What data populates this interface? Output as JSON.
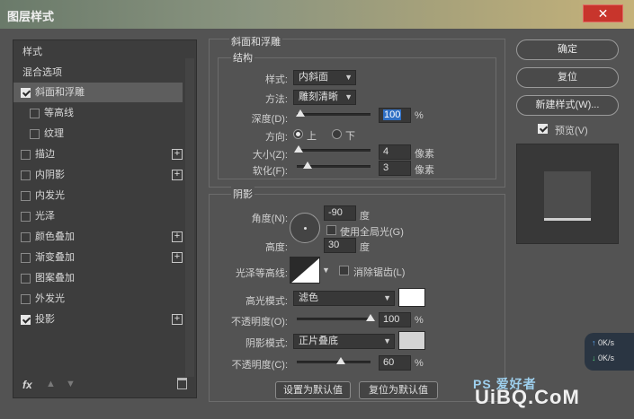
{
  "window": {
    "title": "图层样式",
    "close": "✕"
  },
  "left": {
    "items": [
      {
        "label": "样式",
        "type": "head"
      },
      {
        "label": "混合选项",
        "type": "head"
      },
      {
        "label": "斜面和浮雕",
        "checked": true,
        "selected": true,
        "plus": false
      },
      {
        "label": "等高线",
        "checked": false,
        "sub": true
      },
      {
        "label": "纹理",
        "checked": false,
        "sub": true
      },
      {
        "label": "描边",
        "checked": false,
        "plus": true
      },
      {
        "label": "内阴影",
        "checked": false,
        "plus": true
      },
      {
        "label": "内发光",
        "checked": false,
        "plus": false
      },
      {
        "label": "光泽",
        "checked": false,
        "plus": false
      },
      {
        "label": "颜色叠加",
        "checked": false,
        "plus": true
      },
      {
        "label": "渐变叠加",
        "checked": false,
        "plus": true
      },
      {
        "label": "图案叠加",
        "checked": false,
        "plus": false
      },
      {
        "label": "外发光",
        "checked": false,
        "plus": false
      },
      {
        "label": "投影",
        "checked": true,
        "plus": true
      }
    ],
    "fx": "fx"
  },
  "bevel": {
    "title": "斜面和浮雕",
    "structure": "结构",
    "style_label": "样式:",
    "style_value": "内斜面",
    "method_label": "方法:",
    "method_value": "雕刻清晰",
    "depth_label": "深度(D):",
    "depth_value": "100",
    "depth_unit": "%",
    "depth_level": 0.05,
    "direction_label": "方向:",
    "dir_up": "上",
    "dir_down": "下",
    "size_label": "大小(Z):",
    "size_value": "4",
    "size_unit": "像素",
    "size_level": 0.03,
    "soften_label": "软化(F):",
    "soften_value": "3",
    "soften_unit": "像素",
    "soften_level": 0.15
  },
  "shading": {
    "title": "阴影",
    "angle_label": "角度(N):",
    "angle_value": "-90",
    "angle_unit": "度",
    "global_light": "使用全局光(G)",
    "altitude_label": "高度:",
    "altitude_value": "30",
    "altitude_unit": "度",
    "gloss_label": "光泽等高线:",
    "antialias": "消除锯齿(L)",
    "highlight_label": "高光模式:",
    "highlight_value": "滤色",
    "highlight_color": "#ffffff",
    "hl_opacity_label": "不透明度(O):",
    "hl_opacity_value": "100",
    "hl_opacity_unit": "%",
    "hl_opacity_level": 1.0,
    "shadow_label": "阴影模式:",
    "shadow_value": "正片叠底",
    "shadow_color": "#d4d4d4",
    "sh_opacity_label": "不透明度(C):",
    "sh_opacity_value": "60",
    "sh_opacity_unit": "%",
    "sh_opacity_level": 0.6
  },
  "buttons": {
    "set_default": "设置为默认值",
    "reset_default": "复位为默认值"
  },
  "right": {
    "ok": "确定",
    "reset": "复位",
    "new_style": "新建样式(W)...",
    "preview": "预览(V)"
  },
  "network": {
    "up": "0K/s",
    "down": "0K/s"
  },
  "watermark": {
    "site": "UiBQ.CoM",
    "ps": "PS 爱好者"
  }
}
